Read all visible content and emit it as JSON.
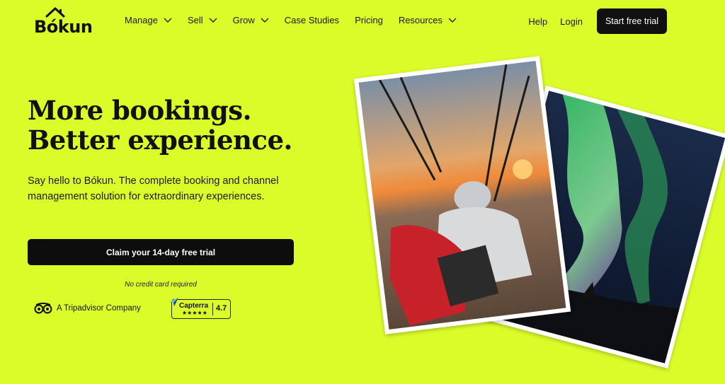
{
  "brand": {
    "name": "Bókun"
  },
  "nav": {
    "items": [
      {
        "label": "Manage",
        "has_dropdown": true
      },
      {
        "label": "Sell",
        "has_dropdown": true
      },
      {
        "label": "Grow",
        "has_dropdown": true
      },
      {
        "label": "Case Studies",
        "has_dropdown": false
      },
      {
        "label": "Pricing",
        "has_dropdown": false
      },
      {
        "label": "Resources",
        "has_dropdown": true
      }
    ],
    "help_label": "Help",
    "login_label": "Login",
    "start_trial_label": "Start free trial"
  },
  "hero": {
    "headline_line1": "More bookings.",
    "headline_line2": "Better experience.",
    "subtext": "Say hello to Bókun. The complete booking and channel management solution for extraordinary experiences.",
    "cta_label": "Claim your 14-day free trial",
    "no_credit_card": "No credit card required"
  },
  "badges": {
    "tripadvisor": "A Tripadvisor Company",
    "capterra_name": "Capterra",
    "capterra_stars": "★★★★★",
    "capterra_rating": "4.7"
  },
  "images": {
    "photo1": "paragliding-sunset-photo",
    "photo2": "northern-lights-photo"
  },
  "colors": {
    "background": "#dcfc2a",
    "button": "#0d0d0d",
    "button_text": "#ffffff"
  }
}
